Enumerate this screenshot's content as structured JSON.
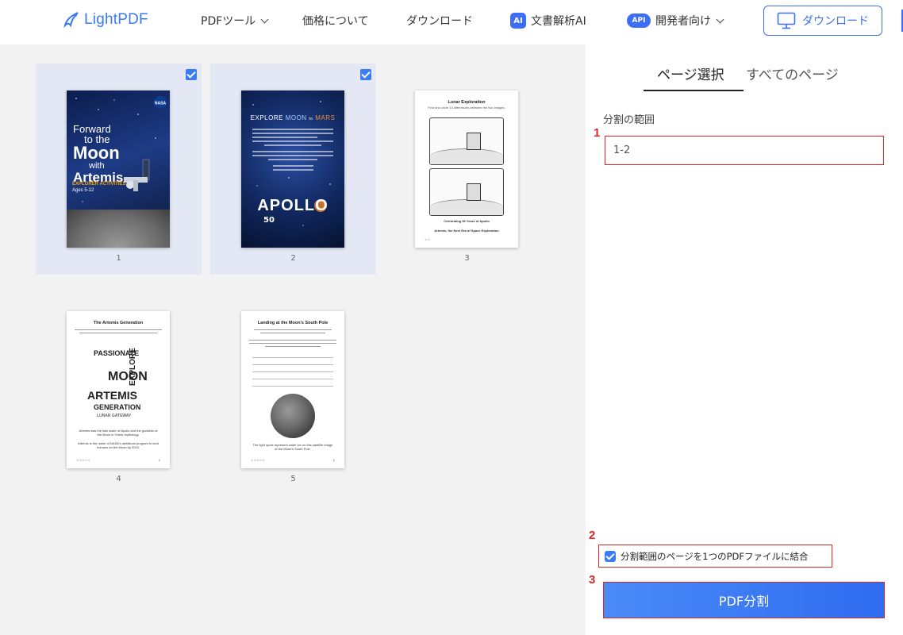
{
  "header": {
    "logo_text": "LightPDF",
    "nav": [
      {
        "label": "PDFツール",
        "has_dropdown": true
      },
      {
        "label": "価格について",
        "has_dropdown": false
      },
      {
        "label": "ダウンロード",
        "has_dropdown": false
      },
      {
        "label": "文書解析AI",
        "badge": "AI",
        "has_dropdown": false
      },
      {
        "label": "開発者向け",
        "badge": "API",
        "has_dropdown": true
      }
    ],
    "download_button": "ダウンロード"
  },
  "thumbnails": [
    {
      "page_number": "1",
      "selected": true,
      "cover": {
        "title_lines": [
          "Forward",
          "to the",
          "Moon",
          "with",
          "Artemis"
        ],
        "subtitle": "EXPLORER ACTIVITIES",
        "ages": "Ages 5-12"
      }
    },
    {
      "page_number": "2",
      "selected": true,
      "cover": {
        "explore": "EXPLORE",
        "moon": "MOON",
        "to": "to",
        "mars": "MARS",
        "apollo": "APOLLO",
        "anniv": "50"
      }
    },
    {
      "page_number": "3",
      "selected": false,
      "content": {
        "title": "Lunar Exploration",
        "subtitle": "Find and circle 10 differences between the two images.",
        "footer1": "Celebrating 50 Years of Apollo",
        "footer2": "Artemis, the Next Era of Space Exploration"
      }
    },
    {
      "page_number": "4",
      "selected": false,
      "content": {
        "title": "The Artemis Generation",
        "words": [
          "PASSIONATE",
          "MOON",
          "ARTEMIS",
          "GENERATION",
          "EXPLORE",
          "LUNAR GATEWAY"
        ],
        "caption1": "Artemis was the twin sister of Apollo and the goddess of the Moon in Greek mythology.",
        "caption2": "Artemis is the name of NASA's ambitious program to land humans on the Moon by 2024."
      }
    },
    {
      "page_number": "5",
      "selected": false,
      "content": {
        "title": "Landing at the Moon's South Pole",
        "caption": "The light spots represent water ice on this satellite image of the Moon's South Pole."
      }
    }
  ],
  "panel": {
    "tabs": [
      {
        "label": "ページ選択",
        "active": true
      },
      {
        "label": "すべてのページ",
        "active": false
      }
    ],
    "range_label": "分割の範囲",
    "range_value": "1-2",
    "merge_checkbox_label": "分割範囲のページを1つのPDFファイルに結合",
    "merge_checked": true,
    "split_button": "PDF分割",
    "markers": [
      "1",
      "2",
      "3"
    ]
  },
  "colors": {
    "accent": "#3b6ef5",
    "annotation_red": "#e02424",
    "left_bg": "#f2f2f3",
    "selected_card_bg": "#e4e8f4"
  }
}
